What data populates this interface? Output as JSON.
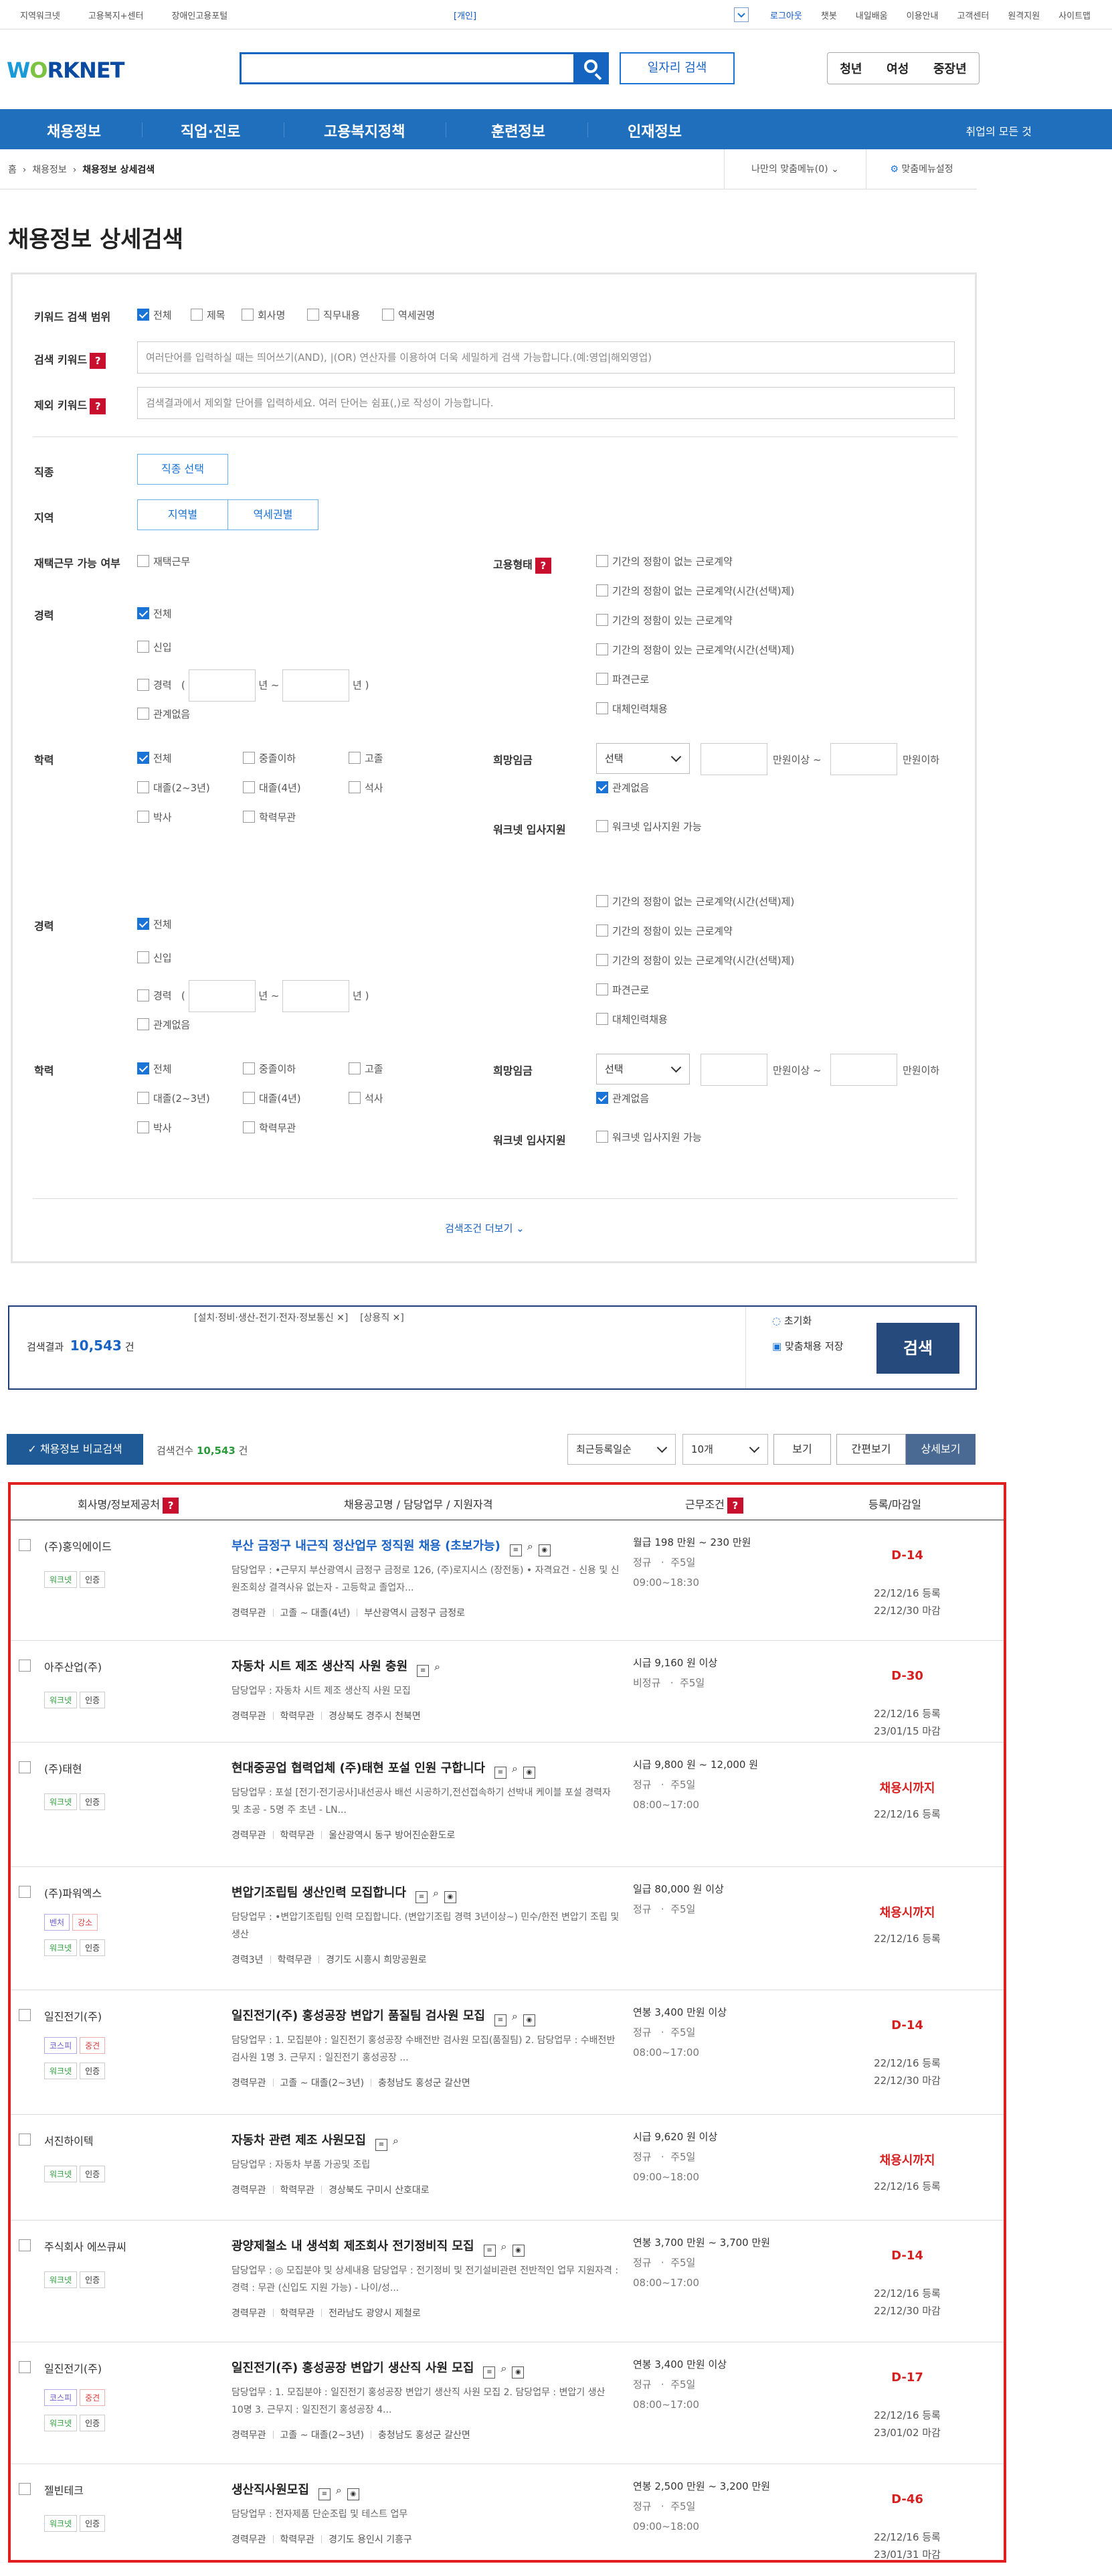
{
  "util": {
    "left": [
      "지역워크넷",
      "고용복지+센터",
      "장애인고용포털"
    ],
    "mid": "[개인]",
    "right": [
      "로그아웃",
      "챗봇",
      "내일배움",
      "이용안내",
      "고객센터",
      "원격지원",
      "사이트맵"
    ]
  },
  "header": {
    "logo": "WORKNET",
    "search_placeholder": "",
    "job_search": "일자리 검색",
    "age_tabs": [
      "청년",
      "여성",
      "중장년"
    ]
  },
  "nav": {
    "items": [
      "채용정보",
      "직업·진로",
      "고용복지정책",
      "훈련정보",
      "인재정보"
    ],
    "all": "취업의 모든 것"
  },
  "breadcrumb": {
    "home": "홈",
    "c1": "채용정보",
    "c2": "채용정보 상세검색",
    "my_menu": "나만의 맞춤메뉴(0)",
    "menu_setting": "맞춤메뉴설정"
  },
  "page_title": "채용정보 상세검색",
  "form": {
    "kw_scope_label": "키워드 검색 범위",
    "kw_scope_opts": [
      "전체",
      "제목",
      "회사명",
      "직무내용",
      "역세권명"
    ],
    "kw_label": "검색 키워드",
    "kw_placeholder": "여러단어를 입력하실 때는 띄어쓰기(AND), |(OR) 연산자를 이용하여 더욱 세밀하게 검색 가능합니다.(예:영업|해외영업)",
    "ex_label": "제외 키워드",
    "ex_placeholder": "검색결과에서 제외할 단어를 입력하세요. 여러 단어는 쉼표(,)로 작성이 가능합니다.",
    "job_label": "직종",
    "job_btn": "직종 선택",
    "region_label": "지역",
    "region_btn1": "지역별",
    "region_btn2": "역세권별",
    "remote_label": "재택근무 가능 여부",
    "remote_opt": "재택근무",
    "emp_label": "고용형태",
    "emp_opts": [
      "기간의 정함이 없는 근로계약",
      "기간의 정함이 없는 근로계약(시간(선택)제)",
      "기간의 정함이 있는 근로계약",
      "기간의 정함이 있는 근로계약(시간(선택)제)",
      "파견근로",
      "대체인력채용"
    ],
    "career_label": "경력",
    "career_opts": [
      "전체",
      "신입",
      "경력",
      "관계없음"
    ],
    "year_from": "년 ~",
    "year_to": "년 )",
    "edu_label": "학력",
    "edu_opts": [
      "전체",
      "중졸이하",
      "고졸",
      "대졸(2~3년)",
      "대졸(4년)",
      "석사",
      "박사",
      "학력무관"
    ],
    "wage_label": "희망임금",
    "wage_select": "선택",
    "wage_from": "만원이상 ~",
    "wage_to": "만원이하",
    "wage_none": "관계없음",
    "support_label": "워크넷 입사지원",
    "support_opt": "워크넷 입사지원 가능",
    "more": "검색조건 더보기"
  },
  "result_box": {
    "tags": [
      "[설치·정비·생산-전기·전자·정보통신 ✕]",
      "[상용직 ✕]"
    ],
    "count_label": "검색결과",
    "count": "10,543",
    "count_unit": "건",
    "reset": "초기화",
    "save": "맞춤채용 저장",
    "search": "검색"
  },
  "listbar": {
    "compare": "채용정보 비교검색",
    "count_label": "검색건수",
    "count": "10,543",
    "count_unit": "건",
    "sort": "최근등록일순",
    "per": "10개",
    "view": "보기",
    "simple": "간편보기",
    "detail": "상세보기"
  },
  "table_head": [
    "회사명/정보제공처",
    "채용공고명 / 담당업무 / 지원자격",
    "근무조건",
    "등록/마감일"
  ],
  "rows": [
    {
      "company": "(주)홍익에이드",
      "tags": [
        "워크넷",
        "인증"
      ],
      "title": "부산 금정구 내근직 정산업무 정직원 채용 (초보가능)",
      "desc": "담당업무 : •근무지 부산광역시 금정구 금정로 126, (주)로지시스 (장전동) • 자격요건 - 신용 및 신원조회상 결격사유 없는자 - 고등학교 졸업자...",
      "meta": [
        "경력무관",
        "고졸 ~ 대졸(4년)",
        "부산광역시 금정구 금정로"
      ],
      "wage": "월급 198 만원 ~ 230 만원",
      "c2": "정규",
      "c3": "주5일",
      "hours": "09:00~18:30",
      "d": "D-14",
      "reg": "22/12/16 등록",
      "end": "22/12/30 마감"
    },
    {
      "company": "아주산업(주)",
      "tags": [
        "워크넷",
        "인증"
      ],
      "title": "자동차 시트 제조 생산직 사원 충원",
      "desc": "담당업무 : 자동차 시트 제조 생산직 사원 모집",
      "meta": [
        "경력무관",
        "학력무관",
        "경상북도 경주시 천북면"
      ],
      "wage": "시급 9,160 원 이상",
      "c2": "비정규",
      "c3": "주5일",
      "hours": "",
      "d": "D-30",
      "reg": "22/12/16 등록",
      "end": "23/01/15 마감"
    },
    {
      "company": "(주)태현",
      "tags": [
        "워크넷",
        "인증"
      ],
      "title": "현대중공업 협력업체 (주)태현 포설 인원 구합니다",
      "desc": "담당업무 : 포설 [전기·전기공사]내선공사 배선 시공하기,전선접속하기 선박내 케이블 포설 경력자 및 초공 - 5명 주 초년 - LN...",
      "meta": [
        "경력무관",
        "학력무관",
        "울산광역시 동구 방어진순환도로"
      ],
      "wage": "시급 9,800 원 ~ 12,000 원",
      "c2": "정규",
      "c3": "주5일",
      "hours": "08:00~17:00",
      "d": "채용시까지",
      "reg": "22/12/16 등록",
      "end": ""
    },
    {
      "company": "(주)파워엑스",
      "tags": [
        "벤처",
        "강소",
        "워크넷",
        "인증"
      ],
      "title": "변압기조립팀 생산인력 모집합니다",
      "desc": "담당업무 : •변압기조립팀 인력 모집합니다. (변압기조립 경력 3년이상~) 민수/한전 변압기 조립 및 생산",
      "meta": [
        "경력3년",
        "학력무관",
        "경기도 시흥시 희망공원로"
      ],
      "wage": "일급 80,000 원 이상",
      "c2": "정규",
      "c3": "주5일",
      "hours": "",
      "d": "채용시까지",
      "reg": "22/12/16 등록",
      "end": ""
    },
    {
      "company": "일진전기(주)",
      "tags": [
        "코스피",
        "중견",
        "워크넷",
        "인증"
      ],
      "title": "일진전기(주) 홍성공장 변압기 품질팀 검사원 모집",
      "desc": "담당업무 : 1. 모집분야 : 일진전기 홍성공장 수배전반 검사원 모집(품질팀) 2. 담당업무 : 수배전반 검사원 1명 3. 근무지 : 일진전기 홍성공장 ...",
      "meta": [
        "경력무관",
        "고졸 ~ 대졸(2~3년)",
        "충청남도 홍성군 갈산면"
      ],
      "wage": "연봉 3,400 만원 이상",
      "c2": "정규",
      "c3": "주5일",
      "hours": "08:00~17:00",
      "d": "D-14",
      "reg": "22/12/16 등록",
      "end": "22/12/30 마감"
    },
    {
      "company": "서진하이텍",
      "tags": [
        "워크넷",
        "인증"
      ],
      "title": "자동차 관련 제조 사원모집",
      "desc": "담당업무 : 자동차 부품 가공및 조립",
      "meta": [
        "경력무관",
        "학력무관",
        "경상북도 구미시 산호대로"
      ],
      "wage": "시급 9,620 원 이상",
      "c2": "정규",
      "c3": "주5일",
      "hours": "09:00~18:00",
      "d": "채용시까지",
      "reg": "22/12/16 등록",
      "end": ""
    },
    {
      "company": "주식회사 에쓰큐씨",
      "tags": [
        "워크넷",
        "인증"
      ],
      "title": "광양제철소 내 생석회 제조회사 전기정비직 모집",
      "desc": "담당업무 : ◎ 모집분야 및 상세내용 담당업무 : 전기정비 및 전기설비관련 전반적인 업무 지원자격 : 경력 : 무관 (신입도 지원 가능) - 나이/성...",
      "meta": [
        "경력무관",
        "학력무관",
        "전라남도 광양시 제철로"
      ],
      "wage": "연봉 3,700 만원 ~ 3,700 만원",
      "c2": "정규",
      "c3": "주5일",
      "hours": "08:00~17:00",
      "d": "D-14",
      "reg": "22/12/16 등록",
      "end": "22/12/30 마감"
    },
    {
      "company": "일진전기(주)",
      "tags": [
        "코스피",
        "중견",
        "워크넷",
        "인증"
      ],
      "title": "일진전기(주) 홍성공장 변압기 생산직 사원 모집",
      "desc": "담당업무 : 1. 모집분야 : 일진전기 홍성공장 변압기 생산직 사원 모집 2. 담당업무 : 변압기 생산 10명 3. 근무지 : 일진전기 홍성공장 4...",
      "meta": [
        "경력무관",
        "고졸 ~ 대졸(2~3년)",
        "충청남도 홍성군 갈산면"
      ],
      "wage": "연봉 3,400 만원 이상",
      "c2": "정규",
      "c3": "주5일",
      "hours": "08:00~17:00",
      "d": "D-17",
      "reg": "22/12/16 등록",
      "end": "23/01/02 마감"
    },
    {
      "company": "젤빈테크",
      "tags": [
        "워크넷",
        "인증"
      ],
      "title": "생산직사원모집",
      "desc": "담당업무 : 전자제품 단순조립 및 테스트 업무",
      "meta": [
        "경력무관",
        "학력무관",
        "경기도 용인시 기흥구"
      ],
      "wage": "연봉 2,500 만원 ~ 3,200 만원",
      "c2": "정규",
      "c3": "주5일",
      "hours": "09:00~18:00",
      "d": "D-46",
      "reg": "22/12/16 등록",
      "end": "23/01/31 마감"
    }
  ]
}
